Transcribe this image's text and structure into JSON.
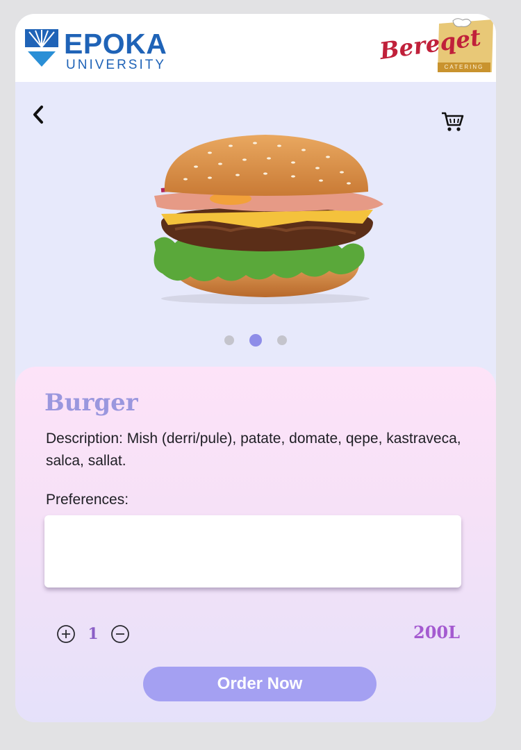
{
  "header": {
    "left_logo": {
      "name": "EPOKA",
      "subtitle": "UNIVERSITY"
    },
    "right_logo": {
      "name": "Bereqet",
      "subtitle": "CATERING"
    }
  },
  "nav": {
    "back_icon": "chevron-left-icon",
    "cart_icon": "cart-icon"
  },
  "gallery": {
    "image": "burger-image",
    "slides": 3,
    "active_index": 1
  },
  "product": {
    "title": "Burger",
    "description": "Description: Mish (derri/pule), patate, domate, qepe, kastraveca, salca, sallat.",
    "preferences_label": "Preferences:",
    "preferences_value": "",
    "quantity": "1",
    "price": "200L"
  },
  "actions": {
    "order_label": "Order Now"
  },
  "colors": {
    "accent": "#a4a0f2",
    "title": "#9a97de",
    "price": "#a45ad0",
    "epoka_blue": "#1f63b7",
    "bereqet_red": "#c0203a"
  }
}
